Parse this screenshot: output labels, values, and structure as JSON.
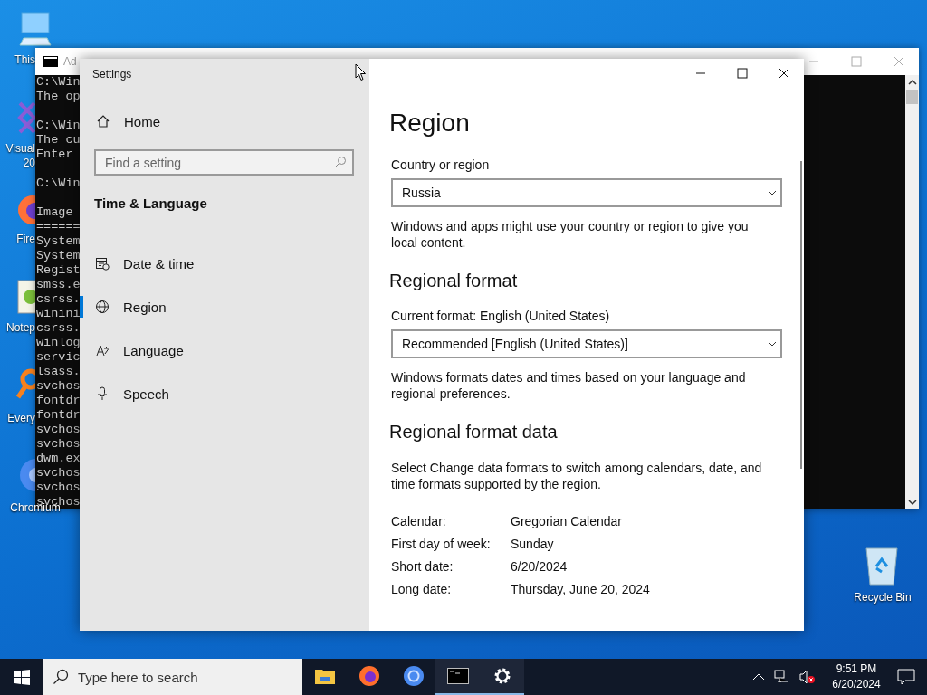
{
  "desktop_icons": [
    {
      "kind": "computer",
      "lines": [
        "This"
      ]
    },
    {
      "kind": "visual-studio",
      "lines": [
        "Visual",
        "20"
      ]
    },
    {
      "kind": "firefox",
      "lines": [
        "Fire"
      ]
    },
    {
      "kind": "notepad",
      "lines": [
        "Notep"
      ]
    },
    {
      "kind": "everything",
      "lines": [
        "Every"
      ]
    },
    {
      "kind": "chromium",
      "lines": [
        "Chromium"
      ]
    },
    {
      "kind": "recycle-bin",
      "lines": [
        "Recycle Bin"
      ]
    }
  ],
  "console": {
    "title": "Ad",
    "blocks": [
      [
        "C:\\Win",
        "The op"
      ],
      [
        "C:\\Win",
        "The cu",
        "Enter"
      ],
      [
        "C:\\Win"
      ],
      [
        "Image",
        "======",
        "System",
        "System",
        "Regist",
        "smss.e",
        "csrss.",
        "winini",
        "csrss.",
        "winlog",
        "servic",
        "lsass.",
        "svchos",
        "fontdr",
        "fontdr",
        "svchos",
        "svchos",
        "dwm.ex",
        "svchos",
        "svchos",
        "svchos"
      ]
    ]
  },
  "settings": {
    "title": "Settings",
    "nav": {
      "home": "Home",
      "search": {
        "placeholder": "Find a setting"
      },
      "section": "Time & Language",
      "items": [
        {
          "kind": "calendar",
          "label": "Date & time",
          "selected": false
        },
        {
          "kind": "globe",
          "label": "Region",
          "selected": true
        },
        {
          "kind": "language",
          "label": "Language",
          "selected": false
        },
        {
          "kind": "mic",
          "label": "Speech",
          "selected": false
        }
      ]
    },
    "page": {
      "title": "Region",
      "country_label": "Country or region",
      "country_value": "Russia",
      "country_note": "Windows and apps might use your country or region to give you local content.",
      "format_heading": "Regional format",
      "format_label": "Current format: English (United States)",
      "format_value": "Recommended [English (United States)]",
      "format_note": "Windows formats dates and times based on your language and regional preferences.",
      "data_heading": "Regional format data",
      "data_note": "Select Change data formats to switch among calendars, date, and time formats supported by the region.",
      "data": [
        {
          "label": "Calendar:",
          "value": "Gregorian Calendar"
        },
        {
          "label": "First day of week:",
          "value": "Sunday"
        },
        {
          "label": "Short date:",
          "value": "6/20/2024"
        },
        {
          "label": "Long date:",
          "value": "Thursday, June 20, 2024"
        }
      ]
    }
  },
  "taskbar": {
    "search": {
      "placeholder": "Type here to search"
    },
    "apps": [
      {
        "kind": "explorer",
        "active": false
      },
      {
        "kind": "firefox",
        "active": false
      },
      {
        "kind": "chromium",
        "active": false
      },
      {
        "kind": "terminal",
        "active": true
      },
      {
        "kind": "settings",
        "active": true
      }
    ],
    "clock": {
      "time": "9:51 PM",
      "date": "6/20/2024"
    }
  }
}
